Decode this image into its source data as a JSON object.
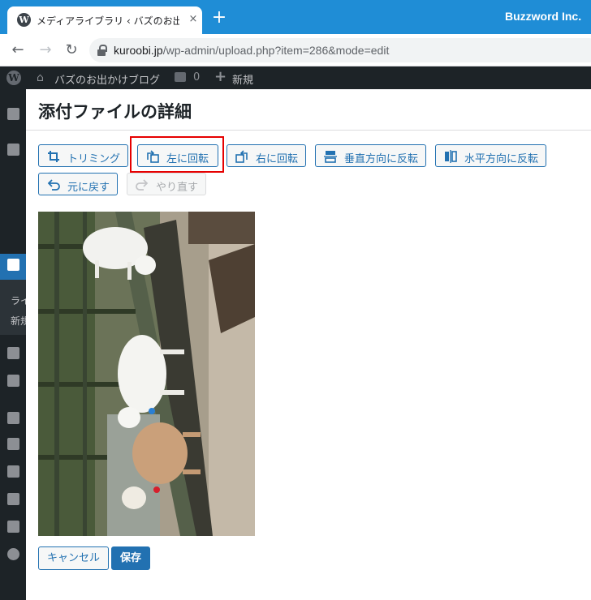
{
  "browser": {
    "tab_title": "メディアライブラリ ‹ バズのお出かけブログ",
    "tab_favicon": "wordpress-icon",
    "tab_close": "×",
    "new_tab": "+",
    "brand": "Buzzword Inc.",
    "url_domain": "kuroobi.jp",
    "url_path": "/wp-admin/upload.php?item=286&mode=edit",
    "nav": {
      "back": "←",
      "forward": "→",
      "reload": "↻"
    }
  },
  "adminbar": {
    "wp_logo": "W",
    "home_glyph": "⌂",
    "site_name": "バズのお出かけブログ",
    "comments_count": "0",
    "new_plus": "+",
    "new_label": "新規"
  },
  "sidebar": {
    "sub_label_1": "ライ",
    "sub_label_2": "新規"
  },
  "modal": {
    "title": "添付ファイルの詳細",
    "buttons": {
      "crop": "トリミング",
      "rotate_left": "左に回転",
      "rotate_right": "右に回転",
      "flip_vertical": "垂直方向に反転",
      "flip_horizontal": "水平方向に反転",
      "undo": "元に戻す",
      "redo": "やり直す"
    },
    "cancel": "キャンセル",
    "save": "保存"
  },
  "colors": {
    "accent": "#2271b1",
    "admin_bar": "#1d2327",
    "tab_strip": "#1f8dd6",
    "highlight": "#e60000"
  }
}
